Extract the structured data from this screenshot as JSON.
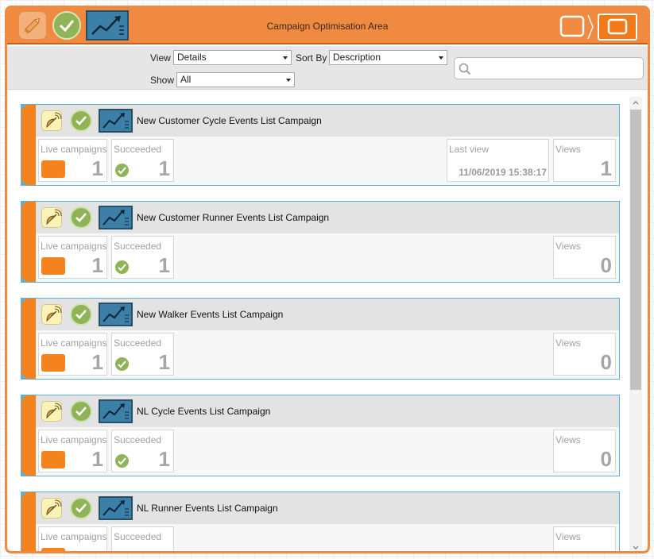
{
  "window": {
    "title": "Campaign Optimisation Area",
    "accent_color": "#ef8a40",
    "icons": [
      "pencil-icon",
      "check-icon",
      "trend-chart-icon",
      "restore-window-icon",
      "maximize-window-icon"
    ]
  },
  "toolbar": {
    "view_label": "View",
    "view_value": "Details",
    "sortby_label": "Sort By",
    "sortby_value": "Description",
    "show_label": "Show",
    "show_value": "All",
    "search_value": ""
  },
  "labels": {
    "live": "Live campaigns",
    "succeeded": "Succeeded",
    "last_view": "Last view",
    "views": "Views"
  },
  "campaigns": [
    {
      "title": "New Customer Cycle Events List Campaign",
      "live": "1",
      "succeeded": "1",
      "last_view": "11/06/2019 15:38:17",
      "views": "1"
    },
    {
      "title": "New Customer Runner Events List Campaign",
      "live": "1",
      "succeeded": "1",
      "views": "0"
    },
    {
      "title": "New Walker Events List Campaign",
      "live": "1",
      "succeeded": "1",
      "views": "0"
    },
    {
      "title": "NL Cycle Events List Campaign",
      "live": "1",
      "succeeded": "1",
      "views": "0"
    },
    {
      "title": "NL Runner Events List Campaign"
    }
  ]
}
